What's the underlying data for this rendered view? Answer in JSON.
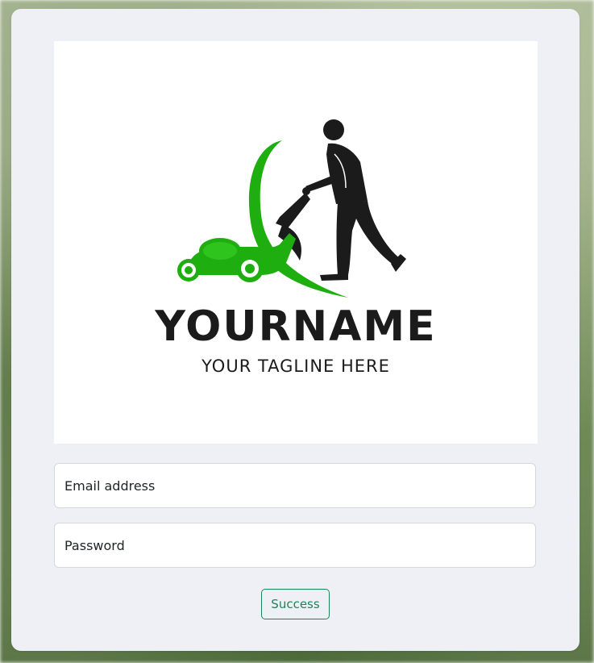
{
  "logo": {
    "brand_name": "YOURNAME",
    "tagline": "YOUR TAGLINE HERE",
    "icon": "lawn-mower-man-icon",
    "accent_color": "#1fae0f",
    "silhouette_color": "#1b1b1b"
  },
  "form": {
    "email_placeholder": "Email address",
    "password_placeholder": "Password",
    "submit_label": "Success",
    "submit_color": "#198754"
  }
}
